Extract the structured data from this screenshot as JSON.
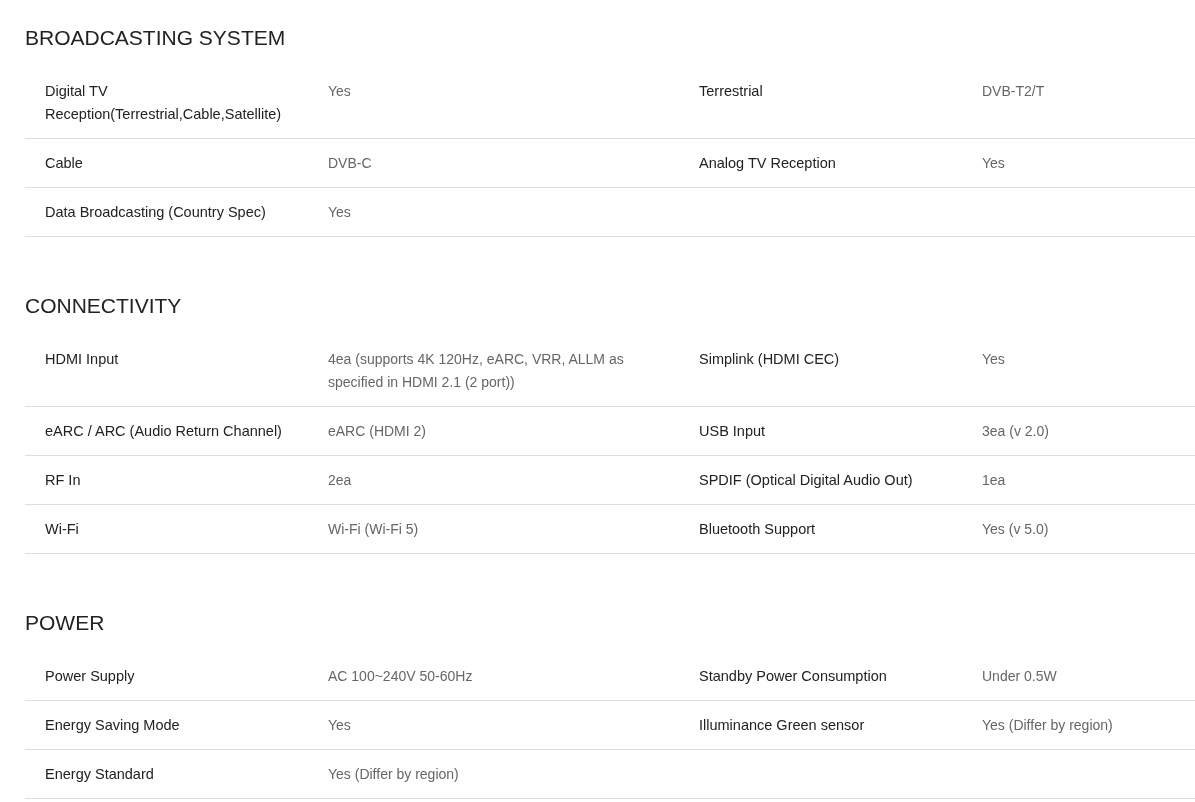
{
  "sections": [
    {
      "title": "BROADCASTING SYSTEM",
      "rows": [
        [
          {
            "label": "Digital TV Reception(Terrestrial,Cable,Satellite)",
            "value": "Yes"
          },
          {
            "label": "Terrestrial",
            "value": "DVB-T2/T"
          }
        ],
        [
          {
            "label": "Cable",
            "value": "DVB-C"
          },
          {
            "label": "Analog TV Reception",
            "value": "Yes"
          }
        ],
        [
          {
            "label": "Data Broadcasting (Country Spec)",
            "value": "Yes"
          }
        ]
      ]
    },
    {
      "title": "CONNECTIVITY",
      "rows": [
        [
          {
            "label": "HDMI Input",
            "value": "4ea (supports 4K 120Hz, eARC, VRR, ALLM as specified in HDMI 2.1 (2 port))"
          },
          {
            "label": "Simplink (HDMI CEC)",
            "value": "Yes"
          }
        ],
        [
          {
            "label": "eARC / ARC (Audio Return Channel)",
            "value": "eARC (HDMI 2)"
          },
          {
            "label": "USB Input",
            "value": "3ea (v 2.0)"
          }
        ],
        [
          {
            "label": "RF In",
            "value": "2ea"
          },
          {
            "label": "SPDIF (Optical Digital Audio Out)",
            "value": "1ea"
          }
        ],
        [
          {
            "label": "Wi-Fi",
            "value": "Wi-Fi (Wi-Fi 5)"
          },
          {
            "label": "Bluetooth Support",
            "value": "Yes (v 5.0)"
          }
        ]
      ]
    },
    {
      "title": "POWER",
      "rows": [
        [
          {
            "label": "Power Supply",
            "value": "AC 100~240V 50-60Hz"
          },
          {
            "label": "Standby Power Consumption",
            "value": "Under 0.5W"
          }
        ],
        [
          {
            "label": "Energy Saving Mode",
            "value": "Yes"
          },
          {
            "label": "Illuminance Green sensor",
            "value": "Yes (Differ by region)"
          }
        ],
        [
          {
            "label": "Energy Standard",
            "value": "Yes (Differ by region)"
          }
        ]
      ]
    }
  ]
}
